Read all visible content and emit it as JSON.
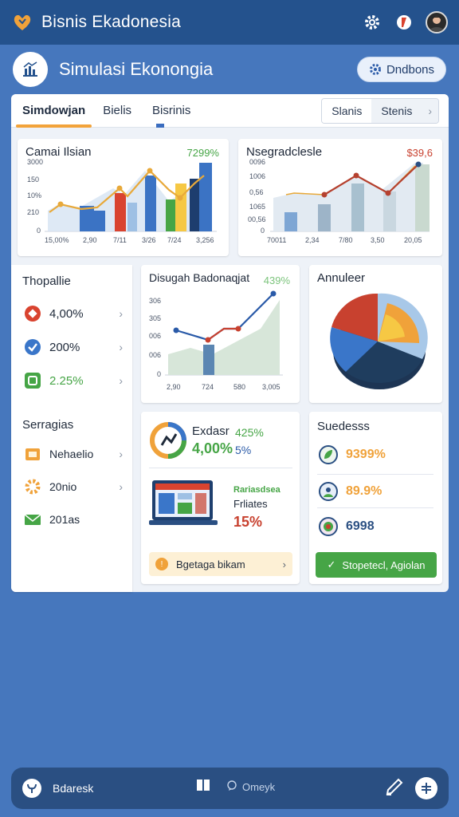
{
  "app": {
    "title": "Bisnis Ekadonesia",
    "brand_color": "#f0a23a"
  },
  "topbar": {
    "icons": [
      "gear-icon",
      "notification-icon",
      "avatar"
    ]
  },
  "header": {
    "title": "Simulasi Ekonongia",
    "button_label": "Dndbons",
    "button_icon": "gear-icon"
  },
  "tabs": {
    "items": [
      "Simdowjan",
      "Bielis",
      "Bisrinis"
    ],
    "active": 0,
    "segments": [
      "Slanis",
      "Stenis"
    ]
  },
  "chart1": {
    "title": "Camai Ilsian",
    "value": "7299%",
    "y_ticks": [
      "3000",
      "150",
      "10%",
      "210",
      "0"
    ],
    "x_ticks": [
      "15,00%",
      "2,90",
      "7/11",
      "3/26",
      "7/24",
      "3,256"
    ]
  },
  "chart2": {
    "title": "Nsegradclesle",
    "value": "$39,6",
    "y_ticks": [
      "0096",
      "1006",
      "0,56",
      "1065",
      "00,56",
      "0"
    ],
    "x_ticks": [
      "70011",
      "2,34",
      "7/80",
      "3,50",
      "20,05"
    ]
  },
  "sidebar": {
    "section1_title": "Thopallie",
    "section1_items": [
      {
        "icon": "warning-icon",
        "label": "4,00%",
        "color": "#d9432f"
      },
      {
        "icon": "check-icon",
        "label": "200%",
        "color": "#3a76c9"
      },
      {
        "icon": "app-icon",
        "label": "2.25%",
        "color": "#46a546"
      }
    ],
    "section2_title": "Serragias",
    "section2_items": [
      {
        "icon": "box-icon",
        "label": "Nehaelio"
      },
      {
        "icon": "gear-icon",
        "label": "20nio"
      },
      {
        "icon": "mail-icon",
        "label": "201as"
      }
    ]
  },
  "chart3": {
    "title": "Disugah Badonaqjat",
    "value": "439%",
    "y_ticks": [
      "306",
      "305",
      "006",
      "006",
      "0"
    ],
    "x_ticks": [
      "2,90",
      "724",
      "580",
      "3,005"
    ]
  },
  "chart4": {
    "title": "Annuleer"
  },
  "exchange": {
    "title": "Exdasr",
    "value_main": "4,00%",
    "value_green": "425%",
    "value_blue": "5%",
    "subtitle_green": "Rariasdsea",
    "subtitle": "Frliates",
    "value_red": "15%",
    "button_label": "Bgetaga bikam"
  },
  "success": {
    "title": "Suedesss",
    "rows": [
      {
        "icon": "leaf-icon",
        "value": "9399%",
        "color": "#f0a23a"
      },
      {
        "icon": "user-icon",
        "value": "89.9%",
        "color": "#f0a23a"
      },
      {
        "icon": "shield-icon",
        "value": "6998",
        "color": "#2a4f82"
      }
    ],
    "button_label": "Stopetecl, Agiolan"
  },
  "bottom": {
    "label": "Bdaresk",
    "center_label": "Omeyk",
    "icons": [
      "book-icon",
      "comment-icon",
      "pen-icon",
      "add-icon"
    ]
  }
}
